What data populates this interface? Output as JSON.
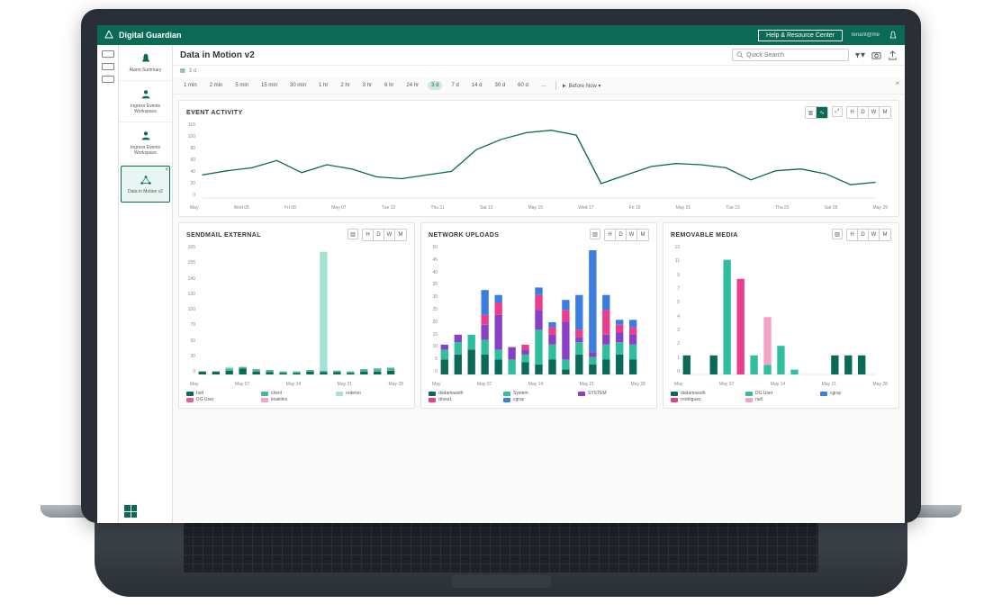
{
  "app": {
    "name": "Digital Guardian"
  },
  "titlebar": {
    "help_label": "Help & Resource Center",
    "user_label": "tenant@me"
  },
  "sidebar": {
    "items": [
      {
        "label": "Alarm Summary"
      },
      {
        "label": "Ingress Events Workspace"
      },
      {
        "label": "Ingress Events Workspace"
      },
      {
        "label": "Data in Motion v2"
      }
    ]
  },
  "page": {
    "title": "Data in Motion v2",
    "subrange": "3 d",
    "search_placeholder": "Quick Search"
  },
  "time_filters": {
    "options": [
      "1 min",
      "2 min",
      "5 min",
      "15 min",
      "30 min",
      "1 hr",
      "2 hr",
      "3 hr",
      "6 hr",
      "24 hr",
      "3 d",
      "7 d",
      "14 d",
      "30 d",
      "60 d",
      "…"
    ],
    "selected": "3 d",
    "suffix_label": "Before Now",
    "play_icon": "►"
  },
  "toolbar_hdwm": [
    "H",
    "D",
    "W",
    "M"
  ],
  "chart_data": [
    {
      "id": "event_activity",
      "title": "EVENT ACTIVITY",
      "type": "line",
      "x": [
        "May",
        "Wed 05",
        "Fri 08",
        "May 07",
        "Tue 12",
        "Thu 11",
        "Sat 13",
        "May 15",
        "Wed 17",
        "Fri 19",
        "May 21",
        "Tue 23",
        "Thu 25",
        "Sat 28",
        "May 29"
      ],
      "y_ticks": [
        0,
        20,
        40,
        60,
        80,
        100,
        116
      ],
      "series": [
        {
          "name": "events",
          "color": "#0a6a56",
          "values": [
            38,
            45,
            50,
            62,
            42,
            55,
            48,
            35,
            32,
            38,
            44,
            80,
            97,
            108,
            112,
            104,
            24,
            38,
            52,
            57,
            55,
            50,
            30,
            45,
            48,
            40,
            22,
            26
          ]
        }
      ],
      "ylim": [
        0,
        116
      ]
    },
    {
      "id": "sendmail_external",
      "title": "SENDMAIL EXTERNAL",
      "type": "bar",
      "stacked": true,
      "x": [
        "May",
        "May 07",
        "May 14",
        "May 21",
        "May 28"
      ],
      "y_ticks": [
        0,
        30,
        50,
        70,
        100,
        130,
        140,
        155,
        165
      ],
      "ylim": [
        0,
        165
      ],
      "series": [
        {
          "name": "holt",
          "color": "#0a6a56"
        },
        {
          "name": "chenl",
          "color": "#4bb59b"
        },
        {
          "name": "roderso",
          "color": "#a4e3d3"
        },
        {
          "name": "DG User",
          "color": "#e85d9a"
        },
        {
          "name": "koaklins",
          "color": "#f2a7c8"
        }
      ],
      "stacks": [
        [
          4,
          0,
          0,
          0,
          0
        ],
        [
          4,
          0,
          0,
          0,
          0
        ],
        [
          5,
          3,
          2,
          0,
          0
        ],
        [
          8,
          2,
          0,
          0,
          0
        ],
        [
          4,
          3,
          0,
          0,
          0
        ],
        [
          3,
          3,
          0,
          0,
          0
        ],
        [
          2,
          2,
          0,
          0,
          0
        ],
        [
          2,
          2,
          0,
          0,
          0
        ],
        [
          4,
          2,
          0,
          0,
          0
        ],
        [
          3,
          2,
          158,
          0,
          0
        ],
        [
          3,
          2,
          0,
          0,
          0
        ],
        [
          2,
          2,
          0,
          0,
          0
        ],
        [
          4,
          3,
          0,
          0,
          0
        ],
        [
          4,
          4,
          0,
          0,
          0
        ],
        [
          5,
          4,
          0,
          0,
          0
        ]
      ]
    },
    {
      "id": "network_uploads",
      "title": "NETWORK UPLOADS",
      "type": "bar",
      "stacked": true,
      "x": [
        "May",
        "May 07",
        "May 14",
        "May 21",
        "May 28"
      ],
      "y_ticks": [
        0,
        5,
        10,
        15,
        20,
        25,
        30,
        35,
        40,
        45,
        50
      ],
      "ylim": [
        0,
        50
      ],
      "series": [
        {
          "name": "dodamasoth",
          "color": "#0a6a56"
        },
        {
          "name": "System",
          "color": "#2fbf9e"
        },
        {
          "name": "SYSTEM",
          "color": "#8a3fc7"
        },
        {
          "name": "dross1",
          "color": "#e83e8c"
        },
        {
          "name": "cgray",
          "color": "#3c7de0"
        }
      ],
      "stacks": [
        [
          6,
          4,
          2,
          0,
          0
        ],
        [
          8,
          5,
          3,
          0,
          0
        ],
        [
          10,
          6,
          0,
          0,
          0
        ],
        [
          8,
          6,
          6,
          4,
          10
        ],
        [
          6,
          4,
          14,
          5,
          3
        ],
        [
          0,
          6,
          5,
          0,
          0
        ],
        [
          5,
          3,
          2,
          2,
          0
        ],
        [
          4,
          14,
          8,
          6,
          3
        ],
        [
          6,
          6,
          4,
          3,
          2
        ],
        [
          2,
          4,
          15,
          5,
          4
        ],
        [
          8,
          5,
          2,
          3,
          14
        ],
        [
          4,
          3,
          2,
          0,
          41
        ],
        [
          6,
          6,
          4,
          10,
          6
        ],
        [
          8,
          5,
          4,
          3,
          2
        ],
        [
          6,
          6,
          4,
          3,
          3
        ]
      ]
    },
    {
      "id": "removable_media",
      "title": "REMOVABLE MEDIA",
      "type": "bar",
      "stacked": true,
      "x": [
        "May",
        "May 07",
        "May 14",
        "May 21",
        "May 28"
      ],
      "y_ticks": [
        0,
        1,
        2,
        3,
        4,
        5,
        7,
        9,
        11,
        13
      ],
      "ylim": [
        0,
        13
      ],
      "series": [
        {
          "name": "dodamasoth",
          "color": "#0a6a56"
        },
        {
          "name": "DG User",
          "color": "#2fbf9e"
        },
        {
          "name": "cgray",
          "color": "#3c7de0"
        },
        {
          "name": "rrodriguez",
          "color": "#e83e8c"
        },
        {
          "name": "null",
          "color": "#f4a3c4"
        }
      ],
      "stacks": [
        [
          2,
          0,
          0,
          0,
          0
        ],
        [
          0,
          0,
          0,
          0,
          0
        ],
        [
          2,
          0,
          0,
          0,
          0
        ],
        [
          0,
          12,
          0,
          0,
          0
        ],
        [
          0,
          0,
          0,
          10,
          0
        ],
        [
          0,
          2,
          0,
          0,
          0
        ],
        [
          0,
          1,
          0,
          0,
          5
        ],
        [
          0,
          3,
          0,
          0,
          0
        ],
        [
          0,
          0.5,
          0,
          0,
          0
        ],
        [
          0,
          0,
          0,
          0,
          0
        ],
        [
          0,
          0,
          0,
          0,
          0
        ],
        [
          2,
          0,
          0,
          0,
          0
        ],
        [
          2,
          0,
          0,
          0,
          0
        ],
        [
          2,
          0,
          0,
          0,
          0
        ],
        [
          0,
          0,
          0,
          0,
          0
        ]
      ]
    }
  ]
}
